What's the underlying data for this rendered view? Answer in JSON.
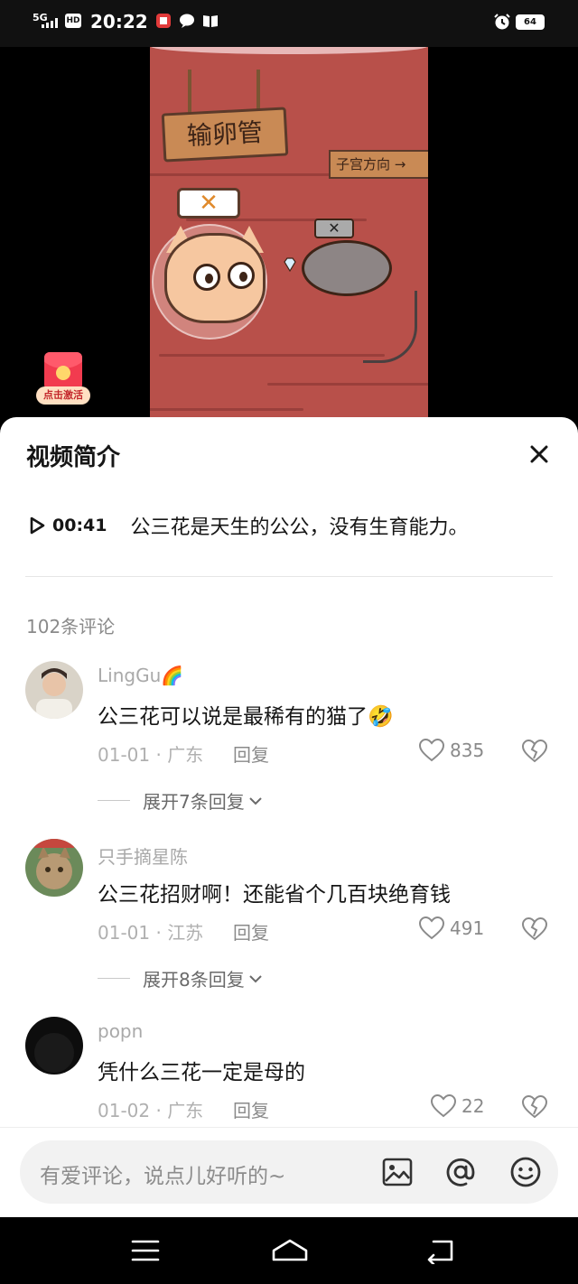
{
  "status_bar": {
    "network": "5G",
    "hd": "HD",
    "time": "20:22",
    "battery": "64"
  },
  "video": {
    "sign_main": "输卵管",
    "sign_direction": "子宫方向 →",
    "tag_x": "✕",
    "tag_x_small": "✕"
  },
  "red_packet": {
    "cta": "点击激活"
  },
  "sheet": {
    "title": "视频简介",
    "description": {
      "time": "00:41",
      "text": "公三花是天生的公公，没有生育能力。"
    },
    "comment_count": "102条评论"
  },
  "comments": [
    {
      "name": "LingGu🌈",
      "text": "公三花可以说是最稀有的猫了🤣",
      "meta": "01-01 · 广东",
      "reply": "回复",
      "likes": "835",
      "expand": "展开7条回复"
    },
    {
      "name": "只手摘星陈",
      "text": "公三花招财啊！还能省个几百块绝育钱",
      "meta": "01-01 · 江苏",
      "reply": "回复",
      "likes": "491",
      "expand": "展开8条回复"
    },
    {
      "name": "popn",
      "text": "凭什么三花一定是母的",
      "meta": "01-02 · 广东",
      "reply": "回复",
      "likes": "22"
    }
  ],
  "input": {
    "placeholder": "有爱评论，说点儿好听的~"
  },
  "colors": {
    "video_bg": "#b8504a",
    "red_packet": "#f23b4f",
    "text_primary": "#161616",
    "text_secondary": "#8a8a8a"
  }
}
